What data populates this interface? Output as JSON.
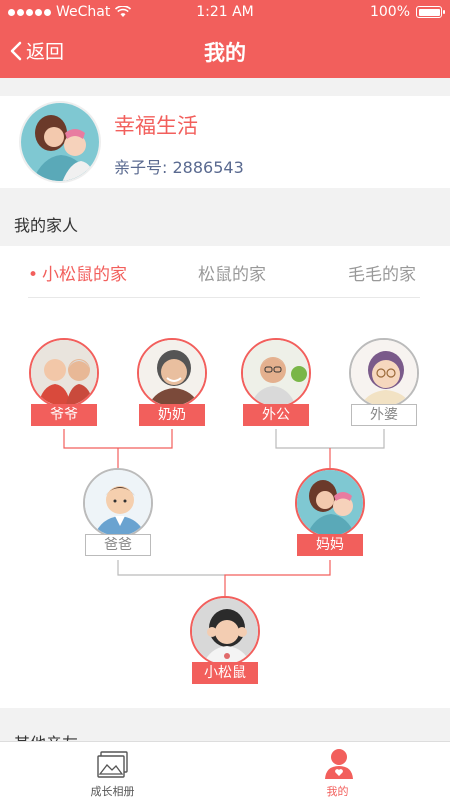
{
  "status": {
    "carrier": "WeChat",
    "time": "1:21 AM",
    "battery": "100%"
  },
  "nav": {
    "back_label": "返回",
    "title": "我的"
  },
  "profile": {
    "name": "幸福生活",
    "id_label": "亲子号:",
    "id_value": "2886543"
  },
  "family_section": {
    "title": "我的家人"
  },
  "family_tabs": [
    {
      "label": "小松鼠的家",
      "active": true
    },
    {
      "label": "松鼠的家",
      "active": false
    },
    {
      "label": "毛毛的家",
      "active": false
    }
  ],
  "family_tree": {
    "grandparents": [
      {
        "label": "爷爷",
        "style": "red"
      },
      {
        "label": "奶奶",
        "style": "red"
      },
      {
        "label": "外公",
        "style": "red"
      },
      {
        "label": "外婆",
        "style": "gray"
      }
    ],
    "parents": [
      {
        "label": "爸爸",
        "style": "gray"
      },
      {
        "label": "妈妈",
        "style": "red"
      }
    ],
    "child": {
      "label": "小松鼠",
      "style": "red"
    }
  },
  "other_section": {
    "title": "其他亲友"
  },
  "tabbar": [
    {
      "label": "成长相册",
      "icon": "photo-album-icon",
      "active": false
    },
    {
      "label": "我的",
      "icon": "user-icon",
      "active": true
    }
  ],
  "colors": {
    "accent": "#f25f5c",
    "gray_border": "#bbbbbb",
    "background": "#f2f2f2"
  }
}
